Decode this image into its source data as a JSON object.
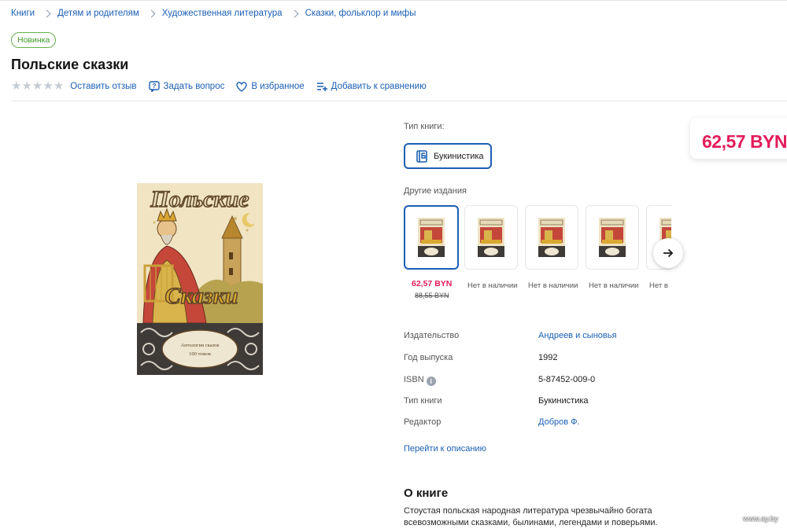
{
  "breadcrumb": [
    "Книги",
    "Детям и родителям",
    "Художественная литература",
    "Сказки, фольклор и мифы"
  ],
  "badge": "Новинка",
  "title": "Польские сказки",
  "actions": {
    "review": "Оставить отзыв",
    "question": "Задать вопрос",
    "favorite": "В избранное",
    "compare": "Добавить к сравнению"
  },
  "rating": {
    "value": 0,
    "max": 5
  },
  "cover": {
    "title_top": "Польские",
    "title_bottom": "Сказки",
    "series": "Антология сказок",
    "series_sub": "100 томов"
  },
  "book_type": {
    "label": "Тип книги:",
    "option": "Букинистика"
  },
  "other_editions": {
    "label": "Другие издания",
    "items": [
      {
        "price": "62,57 BYN",
        "old_price": "88,55 BYN",
        "selected": true
      },
      {
        "status": "Нет в наличии"
      },
      {
        "status": "Нет в наличии"
      },
      {
        "status": "Нет в наличии"
      },
      {
        "status": "Нет в"
      }
    ]
  },
  "price": "62,57 BYN",
  "properties": [
    {
      "key": "Издательство",
      "value": "Андреев и сыновья",
      "link": true
    },
    {
      "key": "Год выпуска",
      "value": "1992",
      "link": false
    },
    {
      "key": "ISBN",
      "value": "5-87452-009-0",
      "link": false,
      "info": true
    },
    {
      "key": "Тип книги",
      "value": "Букинистика",
      "link": false
    },
    {
      "key": "Редактор",
      "value": "Добров Ф.",
      "link": true
    }
  ],
  "to_description": "Перейти к описанию",
  "about": {
    "heading": "О книге",
    "text_line1": "Стоустая польская народная литература чрезвычайно богата",
    "text_line2": "всевозможными сказками, былинами, легендами и поверьями."
  },
  "watermark": "www.ay.by",
  "colors": {
    "accent": "#1b5fb3",
    "price": "#e21d5a",
    "badge": "#63b04a"
  }
}
